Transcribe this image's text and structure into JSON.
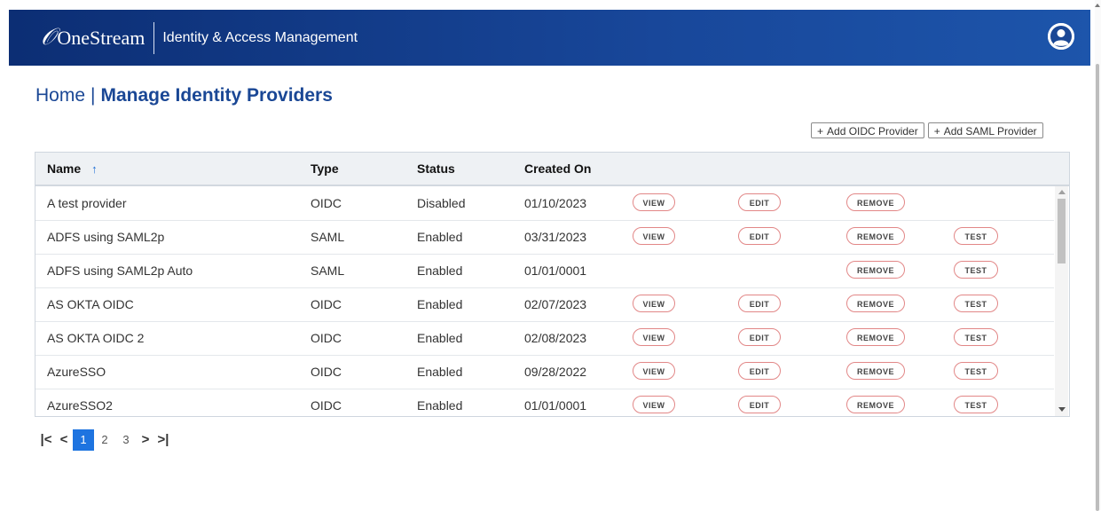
{
  "header": {
    "logo_mark": "𝒪",
    "logo_text": "OneStream",
    "app_title": "Identity & Access Management"
  },
  "breadcrumb": {
    "home": "Home",
    "separator": "|",
    "current": "Manage Identity Providers"
  },
  "actions": {
    "add_oidc": "Add OIDC Provider",
    "add_saml": "Add SAML Provider"
  },
  "table": {
    "columns": [
      "Name",
      "Type",
      "Status",
      "Created On"
    ],
    "sort_indicator": "↑",
    "button_labels": {
      "view": "VIEW",
      "edit": "EDIT",
      "remove": "REMOVE",
      "test": "TEST"
    },
    "rows": [
      {
        "name": "A test provider",
        "type": "OIDC",
        "status": "Disabled",
        "created": "01/10/2023",
        "view": true,
        "edit": true,
        "remove": true,
        "test": false
      },
      {
        "name": "ADFS using SAML2p",
        "type": "SAML",
        "status": "Enabled",
        "created": "03/31/2023",
        "view": true,
        "edit": true,
        "remove": true,
        "test": true
      },
      {
        "name": "ADFS using SAML2p Auto",
        "type": "SAML",
        "status": "Enabled",
        "created": "01/01/0001",
        "view": false,
        "edit": false,
        "remove": true,
        "test": true
      },
      {
        "name": "AS OKTA OIDC",
        "type": "OIDC",
        "status": "Enabled",
        "created": "02/07/2023",
        "view": true,
        "edit": true,
        "remove": true,
        "test": true
      },
      {
        "name": "AS OKTA OIDC 2",
        "type": "OIDC",
        "status": "Enabled",
        "created": "02/08/2023",
        "view": true,
        "edit": true,
        "remove": true,
        "test": true
      },
      {
        "name": "AzureSSO",
        "type": "OIDC",
        "status": "Enabled",
        "created": "09/28/2022",
        "view": true,
        "edit": true,
        "remove": true,
        "test": true
      },
      {
        "name": "AzureSSO2",
        "type": "OIDC",
        "status": "Enabled",
        "created": "01/01/0001",
        "view": true,
        "edit": true,
        "remove": true,
        "test": true
      }
    ]
  },
  "pagination": {
    "first": "|<",
    "prev": "<",
    "pages": [
      "1",
      "2",
      "3"
    ],
    "current_page": "1",
    "next": ">",
    "last": ">|"
  },
  "colors": {
    "header_start": "#0c2e74",
    "header_end": "#1d55ab",
    "accent": "#1e74e0",
    "pill_border": "#e28787",
    "title_blue": "#1a4795"
  },
  "icons": {
    "user": "user-avatar-icon",
    "sort": "sort-ascending-icon"
  }
}
